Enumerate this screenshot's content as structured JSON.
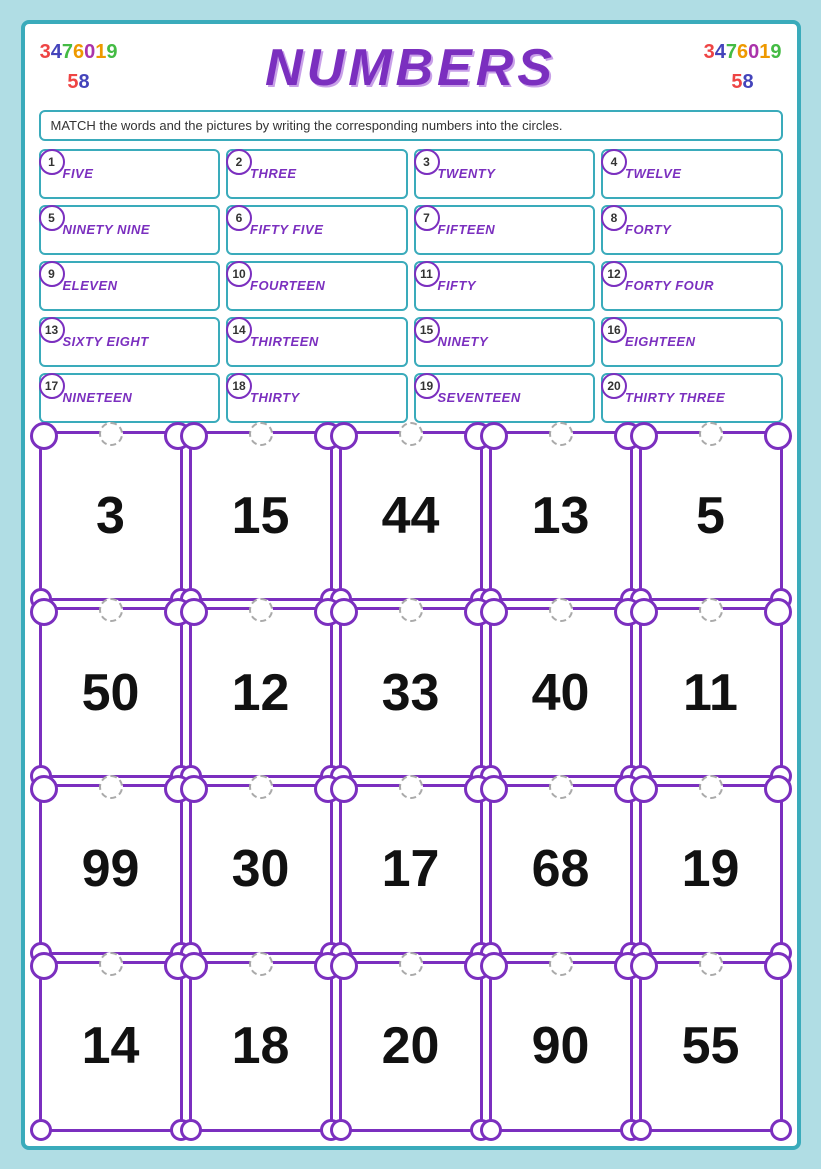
{
  "header": {
    "title": "NUMBERS",
    "instruction": "MATCH the words and the pictures by writing the corresponding numbers into the circles."
  },
  "word_items": [
    {
      "id": 1,
      "word": "FIVE"
    },
    {
      "id": 2,
      "word": "THREE"
    },
    {
      "id": 3,
      "word": "TWENTY"
    },
    {
      "id": 4,
      "word": "TWELVE"
    },
    {
      "id": 5,
      "word": "NINETY NINE"
    },
    {
      "id": 6,
      "word": "FIFTY FIVE"
    },
    {
      "id": 7,
      "word": "FIFTEEN"
    },
    {
      "id": 8,
      "word": "FORTY"
    },
    {
      "id": 9,
      "word": "ELEVEN"
    },
    {
      "id": 10,
      "word": "FOURTEEN"
    },
    {
      "id": 11,
      "word": "FIFTY"
    },
    {
      "id": 12,
      "word": "FORTY FOUR"
    },
    {
      "id": 13,
      "word": "SIXTY EIGHT"
    },
    {
      "id": 14,
      "word": "THIRTEEN"
    },
    {
      "id": 15,
      "word": "NINETY"
    },
    {
      "id": 16,
      "word": "EIGHTEEN"
    },
    {
      "id": 17,
      "word": "NINETEEN"
    },
    {
      "id": 18,
      "word": "THIRTY"
    },
    {
      "id": 19,
      "word": "SEVENTEEN"
    },
    {
      "id": 20,
      "word": "THIRTY THREE"
    }
  ],
  "number_items": [
    "3",
    "15",
    "44",
    "13",
    "5",
    "50",
    "12",
    "33",
    "40",
    "11",
    "99",
    "30",
    "17",
    "68",
    "19",
    "14",
    "18",
    "20",
    "90",
    "55"
  ]
}
